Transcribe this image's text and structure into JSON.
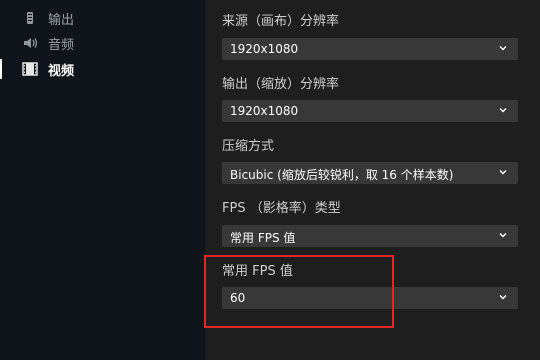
{
  "sidebar": {
    "items": [
      {
        "label": "输出",
        "icon": "output-icon"
      },
      {
        "label": "音频",
        "icon": "speaker-icon"
      },
      {
        "label": "视频",
        "icon": "film-icon",
        "active": true
      }
    ]
  },
  "settings": {
    "base_resolution": {
      "label": "来源（画布）分辨率",
      "value": "1920x1080"
    },
    "output_resolution": {
      "label": "输出（缩放）分辨率",
      "value": "1920x1080"
    },
    "downscale_filter": {
      "label": "压缩方式",
      "value": "Bicubic (缩放后较锐利，取 16 个样本数)"
    },
    "fps_type": {
      "label": "FPS （影格率）类型",
      "value": "常用 FPS 值"
    },
    "common_fps": {
      "label": "常用 FPS 值",
      "value": "60"
    }
  },
  "colors": {
    "sidebar_bg": "#0f151b",
    "content_bg": "#1f1e1f",
    "select_bg": "#383838",
    "highlight_border": "#e02626"
  }
}
